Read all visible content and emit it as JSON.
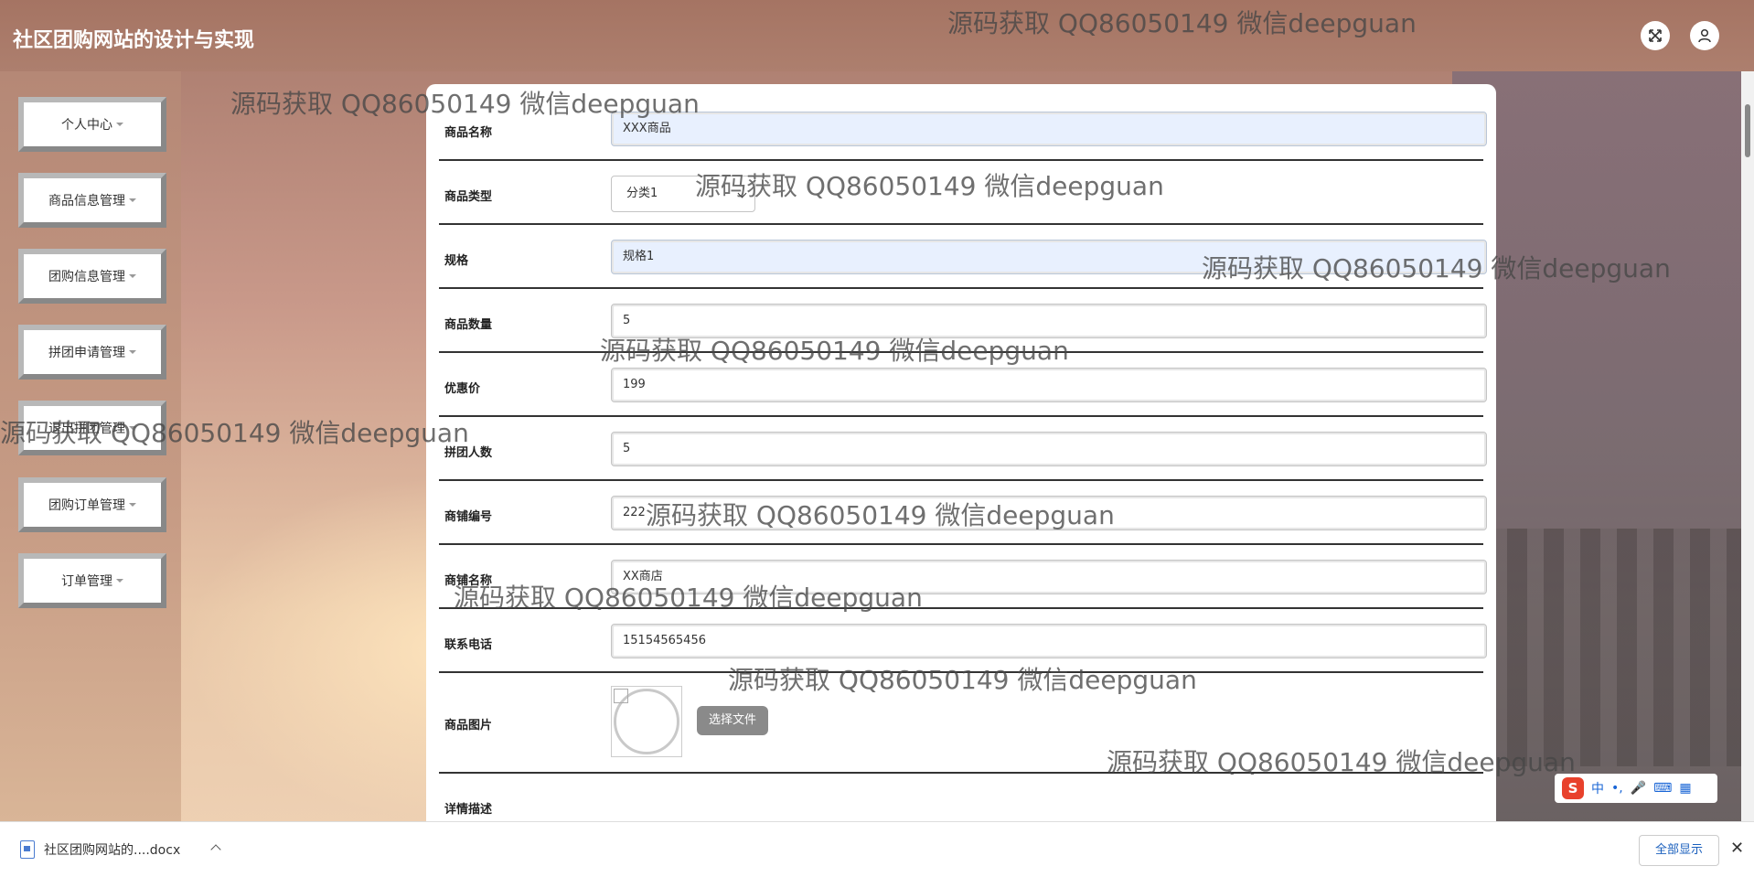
{
  "header": {
    "title": "社区团购网站的设计与实现",
    "fullscreen_icon": "fullscreen-exit-icon",
    "user_icon": "user-icon"
  },
  "sidebar": {
    "items": [
      {
        "label": "个人中心"
      },
      {
        "label": "商品信息管理"
      },
      {
        "label": "团购信息管理"
      },
      {
        "label": "拼团申请管理"
      },
      {
        "label": "退出拼团管理"
      },
      {
        "label": "团购订单管理"
      },
      {
        "label": "订单管理"
      }
    ]
  },
  "form": {
    "rows": [
      {
        "label": "商品名称",
        "value": "XXX商品"
      },
      {
        "label": "商品类型",
        "value": "分类1"
      },
      {
        "label": "规格",
        "value": "规格1"
      },
      {
        "label": "商品数量",
        "value": "5"
      },
      {
        "label": "优惠价",
        "value": "199"
      },
      {
        "label": "拼团人数",
        "value": "5"
      },
      {
        "label": "商铺编号",
        "value": "222"
      },
      {
        "label": "商铺名称",
        "value": "XX商店"
      },
      {
        "label": "联系电话",
        "value": "15154565456"
      },
      {
        "label": "商品图片",
        "button": "选择文件"
      },
      {
        "label": "详情描述"
      }
    ]
  },
  "watermark": "源码获取 QQ86050149 微信deepguan",
  "ime": {
    "labels": [
      "中",
      "•,",
      "🎤",
      "⌨",
      "▦"
    ]
  },
  "downloads": {
    "file": "社区团购网站的....docx",
    "show_all": "全部显示",
    "close": "✕"
  }
}
